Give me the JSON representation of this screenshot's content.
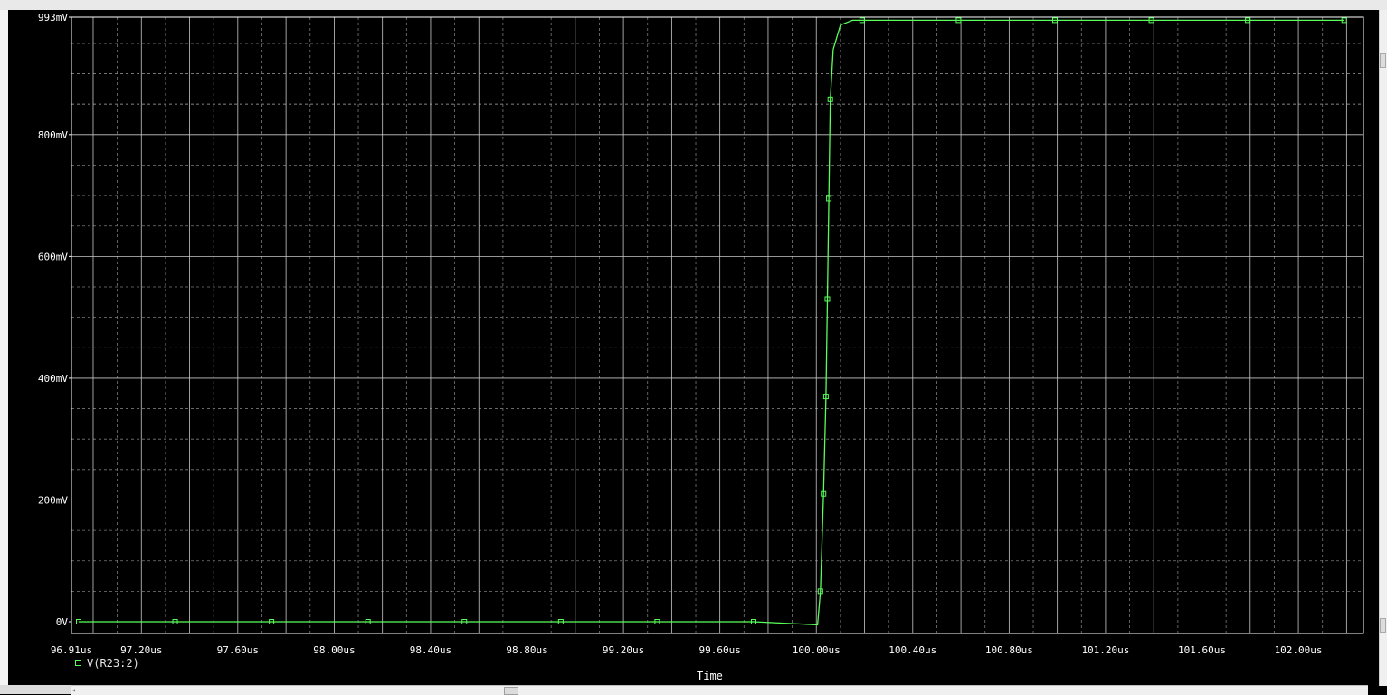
{
  "chart_data": {
    "type": "line",
    "title": "",
    "xlabel": "Time",
    "ylabel": "",
    "xlim": [
      96.91,
      102.27
    ],
    "ylim": [
      0,
      993
    ],
    "grid": true,
    "legend_position": "bottom-left",
    "x_tick_labels": [
      {
        "x": 96.91,
        "label": "96.91us"
      },
      {
        "x": 97.2,
        "label": "97.20us"
      },
      {
        "x": 97.6,
        "label": "97.60us"
      },
      {
        "x": 98.0,
        "label": "98.00us"
      },
      {
        "x": 98.4,
        "label": "98.40us"
      },
      {
        "x": 98.8,
        "label": "98.80us"
      },
      {
        "x": 99.2,
        "label": "99.20us"
      },
      {
        "x": 99.6,
        "label": "99.60us"
      },
      {
        "x": 100.0,
        "label": "100.00us"
      },
      {
        "x": 100.4,
        "label": "100.40us"
      },
      {
        "x": 100.8,
        "label": "100.80us"
      },
      {
        "x": 101.2,
        "label": "101.20us"
      },
      {
        "x": 101.6,
        "label": "101.60us"
      },
      {
        "x": 102.0,
        "label": "102.00us"
      }
    ],
    "y_tick_labels": [
      {
        "y": 0,
        "label": "0V"
      },
      {
        "y": 200,
        "label": "200mV"
      },
      {
        "y": 400,
        "label": "400mV"
      },
      {
        "y": 600,
        "label": "600mV"
      },
      {
        "y": 800,
        "label": "800mV"
      },
      {
        "y": 993,
        "label": "993mV"
      }
    ],
    "series": [
      {
        "name": "V(R23:2)",
        "color": "#58ff58",
        "marker": "square",
        "x": [
          96.94,
          97.34,
          97.74,
          98.14,
          98.54,
          98.94,
          99.34,
          99.74,
          100.005,
          100.017,
          100.03,
          100.04,
          100.046,
          100.052,
          100.058,
          100.07,
          100.1,
          100.15,
          100.19,
          100.59,
          100.99,
          101.39,
          101.79,
          102.19
        ],
        "values": [
          0,
          0,
          0,
          0,
          0,
          0,
          0,
          0,
          -5,
          50,
          210,
          370,
          530,
          695,
          858,
          940,
          980,
          988,
          988,
          988,
          988,
          988,
          988,
          988
        ],
        "marker_x": [
          96.94,
          97.34,
          97.74,
          98.14,
          98.54,
          98.94,
          99.34,
          99.74,
          100.017,
          100.03,
          100.04,
          100.046,
          100.052,
          100.058,
          100.19,
          100.59,
          100.99,
          101.39,
          101.79,
          102.19
        ],
        "marker_values": [
          0,
          0,
          0,
          0,
          0,
          0,
          0,
          0,
          50,
          210,
          370,
          530,
          695,
          858,
          988,
          988,
          988,
          988,
          988,
          988
        ]
      }
    ]
  },
  "colors": {
    "background": "#000000",
    "axis_frame": "#ffffff",
    "grid_major": "#c8c8c8",
    "grid_minor": "#7a7a7a",
    "text": "#ffffff",
    "trace": "#58ff58"
  }
}
